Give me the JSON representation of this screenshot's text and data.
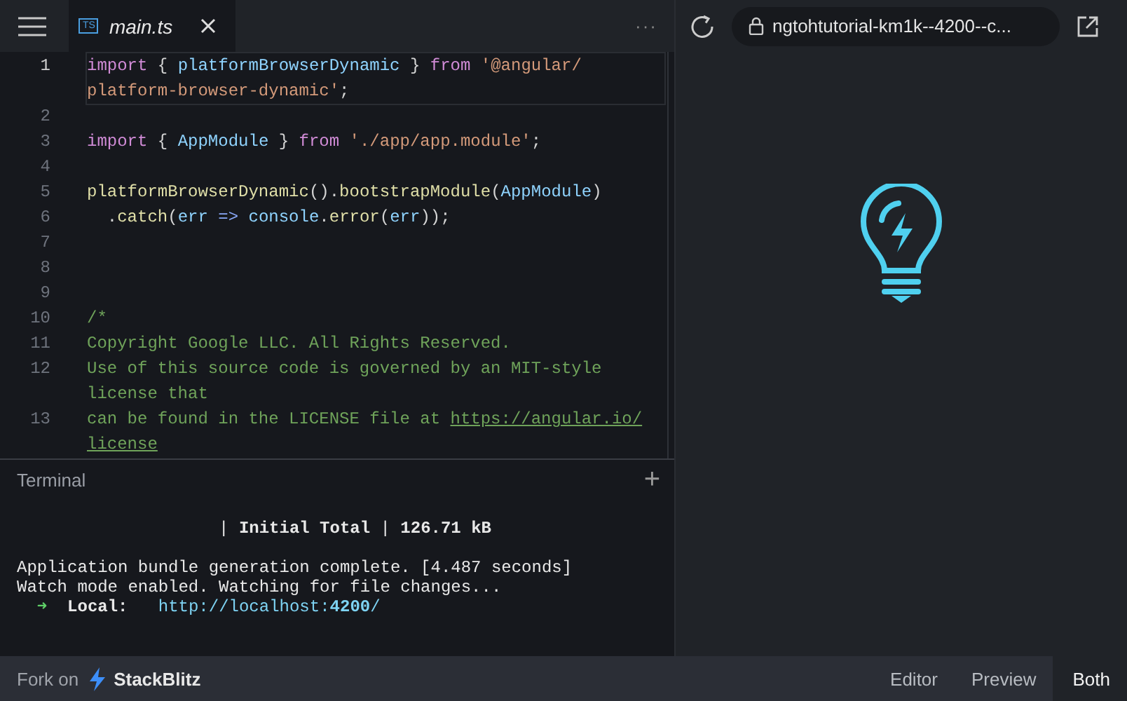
{
  "tabs": [
    {
      "icon": "TS",
      "label": "main.ts",
      "selected": true
    }
  ],
  "more_button": "···",
  "address_bar": {
    "url": "ngtohtutorial-km1k--4200--c..."
  },
  "code_lines": [
    {
      "number": "1",
      "active": true,
      "rows": [
        {
          "tokens": [
            {
              "kind": "kw",
              "text": "import"
            },
            {
              "kind": "punct",
              "text": " { "
            },
            {
              "kind": "ident",
              "text": "platformBrowserDynamic"
            },
            {
              "kind": "punct",
              "text": " } "
            },
            {
              "kind": "kw",
              "text": "from"
            },
            {
              "kind": "str",
              "text": " '@angular/"
            }
          ]
        },
        {
          "tokens": [
            {
              "kind": "str",
              "text": "platform-browser-dynamic'"
            },
            {
              "kind": "punct",
              "text": ";"
            }
          ]
        }
      ]
    },
    {
      "number": "2",
      "active": false,
      "rows": [
        {
          "tokens": []
        }
      ]
    },
    {
      "number": "3",
      "active": false,
      "rows": [
        {
          "tokens": [
            {
              "kind": "kw",
              "text": "import"
            },
            {
              "kind": "punct",
              "text": " { "
            },
            {
              "kind": "ident",
              "text": "AppModule"
            },
            {
              "kind": "punct",
              "text": " } "
            },
            {
              "kind": "kw",
              "text": "from"
            },
            {
              "kind": "str",
              "text": " './app/app.module'"
            },
            {
              "kind": "punct",
              "text": ";"
            }
          ]
        }
      ]
    },
    {
      "number": "4",
      "active": false,
      "rows": [
        {
          "tokens": []
        }
      ]
    },
    {
      "number": "5",
      "active": false,
      "rows": [
        {
          "tokens": [
            {
              "kind": "fn",
              "text": "platformBrowserDynamic"
            },
            {
              "kind": "punct",
              "text": "()."
            },
            {
              "kind": "fn",
              "text": "bootstrapModule"
            },
            {
              "kind": "punct",
              "text": "("
            },
            {
              "kind": "ident",
              "text": "AppModule"
            },
            {
              "kind": "punct",
              "text": ")"
            }
          ]
        }
      ]
    },
    {
      "number": "6",
      "active": false,
      "rows": [
        {
          "tokens": [
            {
              "kind": "punct",
              "text": "  ."
            },
            {
              "kind": "fn",
              "text": "catch"
            },
            {
              "kind": "punct",
              "text": "("
            },
            {
              "kind": "ident",
              "text": "err"
            },
            {
              "kind": "op",
              "text": " => "
            },
            {
              "kind": "ident",
              "text": "console"
            },
            {
              "kind": "punct",
              "text": "."
            },
            {
              "kind": "fn",
              "text": "error"
            },
            {
              "kind": "punct",
              "text": "("
            },
            {
              "kind": "ident",
              "text": "err"
            },
            {
              "kind": "punct",
              "text": "));"
            }
          ]
        }
      ]
    },
    {
      "number": "7",
      "active": false,
      "rows": [
        {
          "tokens": []
        }
      ]
    },
    {
      "number": "8",
      "active": false,
      "rows": [
        {
          "tokens": []
        }
      ]
    },
    {
      "number": "9",
      "active": false,
      "rows": [
        {
          "tokens": []
        }
      ]
    },
    {
      "number": "10",
      "active": false,
      "rows": [
        {
          "tokens": [
            {
              "kind": "comment",
              "text": "/*"
            }
          ]
        }
      ]
    },
    {
      "number": "11",
      "active": false,
      "rows": [
        {
          "tokens": [
            {
              "kind": "comment",
              "text": "Copyright Google LLC. All Rights Reserved."
            }
          ]
        }
      ]
    },
    {
      "number": "12",
      "active": false,
      "rows": [
        {
          "tokens": [
            {
              "kind": "comment",
              "text": "Use of this source code is governed by an MIT-style"
            }
          ]
        },
        {
          "tokens": [
            {
              "kind": "comment",
              "text": "license that"
            }
          ]
        }
      ]
    },
    {
      "number": "13",
      "active": false,
      "rows": [
        {
          "tokens": [
            {
              "kind": "comment",
              "text": "can be found in the LICENSE file at "
            },
            {
              "kind": "link",
              "text": "https://angular.io/"
            }
          ]
        },
        {
          "tokens": [
            {
              "kind": "link",
              "text": "license"
            }
          ]
        }
      ]
    }
  ],
  "terminal": {
    "title": "Terminal",
    "add_button": "+",
    "lines": [
      {
        "segments": [
          {
            "kind": "plain",
            "text": "                    | **Initial Total** | **126.71 kB**"
          }
        ]
      },
      {
        "segments": [
          {
            "kind": "plain",
            "text": "Application bundle generation complete. [4.487 seconds]"
          }
        ]
      },
      {
        "segments": [
          {
            "kind": "plain",
            "text": "Watch mode enabled. Watching for file changes..."
          }
        ]
      },
      {
        "segments": [
          {
            "kind": "arrow",
            "text": "  ➜"
          },
          {
            "kind": "plain",
            "text": "  **Local:**"
          },
          {
            "kind": "url",
            "text": "   http://localhost:**4200**/"
          }
        ]
      }
    ]
  },
  "footer": {
    "fork_label": "Fork on",
    "brand": "StackBlitz",
    "views": [
      {
        "label": "Editor",
        "selected": false
      },
      {
        "label": "Preview",
        "selected": false
      },
      {
        "label": "Both",
        "selected": true
      }
    ]
  }
}
